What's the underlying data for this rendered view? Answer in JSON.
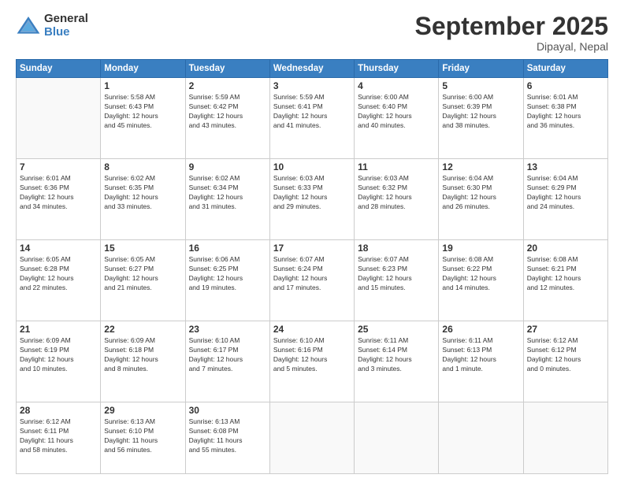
{
  "logo": {
    "general": "General",
    "blue": "Blue"
  },
  "header": {
    "month": "September 2025",
    "location": "Dipayal, Nepal"
  },
  "weekdays": [
    "Sunday",
    "Monday",
    "Tuesday",
    "Wednesday",
    "Thursday",
    "Friday",
    "Saturday"
  ],
  "weeks": [
    [
      {
        "day": "",
        "info": ""
      },
      {
        "day": "1",
        "info": "Sunrise: 5:58 AM\nSunset: 6:43 PM\nDaylight: 12 hours\nand 45 minutes."
      },
      {
        "day": "2",
        "info": "Sunrise: 5:59 AM\nSunset: 6:42 PM\nDaylight: 12 hours\nand 43 minutes."
      },
      {
        "day": "3",
        "info": "Sunrise: 5:59 AM\nSunset: 6:41 PM\nDaylight: 12 hours\nand 41 minutes."
      },
      {
        "day": "4",
        "info": "Sunrise: 6:00 AM\nSunset: 6:40 PM\nDaylight: 12 hours\nand 40 minutes."
      },
      {
        "day": "5",
        "info": "Sunrise: 6:00 AM\nSunset: 6:39 PM\nDaylight: 12 hours\nand 38 minutes."
      },
      {
        "day": "6",
        "info": "Sunrise: 6:01 AM\nSunset: 6:38 PM\nDaylight: 12 hours\nand 36 minutes."
      }
    ],
    [
      {
        "day": "7",
        "info": "Sunrise: 6:01 AM\nSunset: 6:36 PM\nDaylight: 12 hours\nand 34 minutes."
      },
      {
        "day": "8",
        "info": "Sunrise: 6:02 AM\nSunset: 6:35 PM\nDaylight: 12 hours\nand 33 minutes."
      },
      {
        "day": "9",
        "info": "Sunrise: 6:02 AM\nSunset: 6:34 PM\nDaylight: 12 hours\nand 31 minutes."
      },
      {
        "day": "10",
        "info": "Sunrise: 6:03 AM\nSunset: 6:33 PM\nDaylight: 12 hours\nand 29 minutes."
      },
      {
        "day": "11",
        "info": "Sunrise: 6:03 AM\nSunset: 6:32 PM\nDaylight: 12 hours\nand 28 minutes."
      },
      {
        "day": "12",
        "info": "Sunrise: 6:04 AM\nSunset: 6:30 PM\nDaylight: 12 hours\nand 26 minutes."
      },
      {
        "day": "13",
        "info": "Sunrise: 6:04 AM\nSunset: 6:29 PM\nDaylight: 12 hours\nand 24 minutes."
      }
    ],
    [
      {
        "day": "14",
        "info": "Sunrise: 6:05 AM\nSunset: 6:28 PM\nDaylight: 12 hours\nand 22 minutes."
      },
      {
        "day": "15",
        "info": "Sunrise: 6:05 AM\nSunset: 6:27 PM\nDaylight: 12 hours\nand 21 minutes."
      },
      {
        "day": "16",
        "info": "Sunrise: 6:06 AM\nSunset: 6:25 PM\nDaylight: 12 hours\nand 19 minutes."
      },
      {
        "day": "17",
        "info": "Sunrise: 6:07 AM\nSunset: 6:24 PM\nDaylight: 12 hours\nand 17 minutes."
      },
      {
        "day": "18",
        "info": "Sunrise: 6:07 AM\nSunset: 6:23 PM\nDaylight: 12 hours\nand 15 minutes."
      },
      {
        "day": "19",
        "info": "Sunrise: 6:08 AM\nSunset: 6:22 PM\nDaylight: 12 hours\nand 14 minutes."
      },
      {
        "day": "20",
        "info": "Sunrise: 6:08 AM\nSunset: 6:21 PM\nDaylight: 12 hours\nand 12 minutes."
      }
    ],
    [
      {
        "day": "21",
        "info": "Sunrise: 6:09 AM\nSunset: 6:19 PM\nDaylight: 12 hours\nand 10 minutes."
      },
      {
        "day": "22",
        "info": "Sunrise: 6:09 AM\nSunset: 6:18 PM\nDaylight: 12 hours\nand 8 minutes."
      },
      {
        "day": "23",
        "info": "Sunrise: 6:10 AM\nSunset: 6:17 PM\nDaylight: 12 hours\nand 7 minutes."
      },
      {
        "day": "24",
        "info": "Sunrise: 6:10 AM\nSunset: 6:16 PM\nDaylight: 12 hours\nand 5 minutes."
      },
      {
        "day": "25",
        "info": "Sunrise: 6:11 AM\nSunset: 6:14 PM\nDaylight: 12 hours\nand 3 minutes."
      },
      {
        "day": "26",
        "info": "Sunrise: 6:11 AM\nSunset: 6:13 PM\nDaylight: 12 hours\nand 1 minute."
      },
      {
        "day": "27",
        "info": "Sunrise: 6:12 AM\nSunset: 6:12 PM\nDaylight: 12 hours\nand 0 minutes."
      }
    ],
    [
      {
        "day": "28",
        "info": "Sunrise: 6:12 AM\nSunset: 6:11 PM\nDaylight: 11 hours\nand 58 minutes."
      },
      {
        "day": "29",
        "info": "Sunrise: 6:13 AM\nSunset: 6:10 PM\nDaylight: 11 hours\nand 56 minutes."
      },
      {
        "day": "30",
        "info": "Sunrise: 6:13 AM\nSunset: 6:08 PM\nDaylight: 11 hours\nand 55 minutes."
      },
      {
        "day": "",
        "info": ""
      },
      {
        "day": "",
        "info": ""
      },
      {
        "day": "",
        "info": ""
      },
      {
        "day": "",
        "info": ""
      }
    ]
  ]
}
